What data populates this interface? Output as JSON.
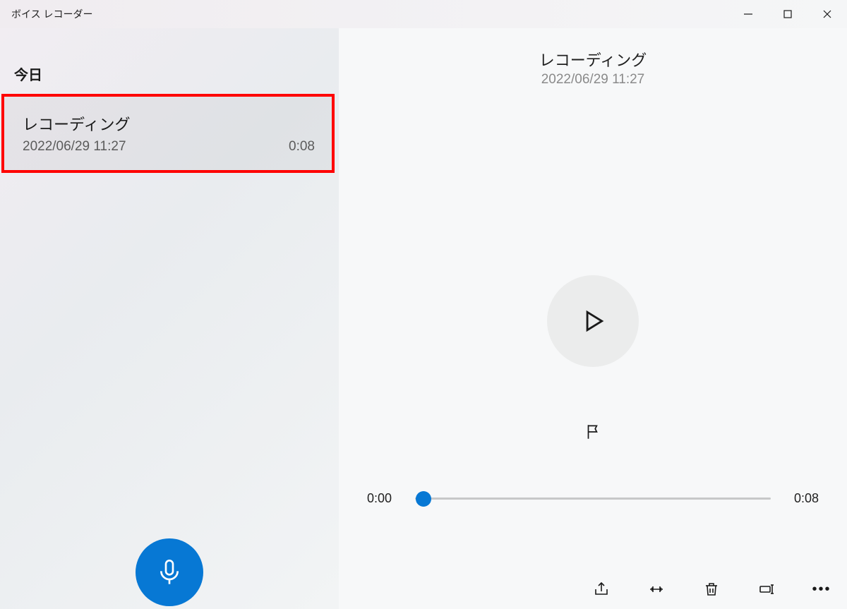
{
  "window": {
    "title": "ボイス レコーダー"
  },
  "sidebar": {
    "sectionHeader": "今日",
    "recordings": [
      {
        "title": "レコーディング",
        "date": "2022/06/29 11:27",
        "duration": "0:08",
        "highlighted": true
      }
    ]
  },
  "detail": {
    "title": "レコーディング",
    "date": "2022/06/29 11:27",
    "playback": {
      "currentTime": "0:00",
      "totalTime": "0:08"
    }
  },
  "icons": {
    "minimize": "minimize-icon",
    "maximize": "maximize-icon",
    "close": "close-icon",
    "mic": "microphone-icon",
    "play": "play-icon",
    "flag": "flag-icon",
    "share": "share-icon",
    "trim": "trim-icon",
    "delete": "trash-icon",
    "rename": "rename-icon",
    "more": "more-icon"
  }
}
